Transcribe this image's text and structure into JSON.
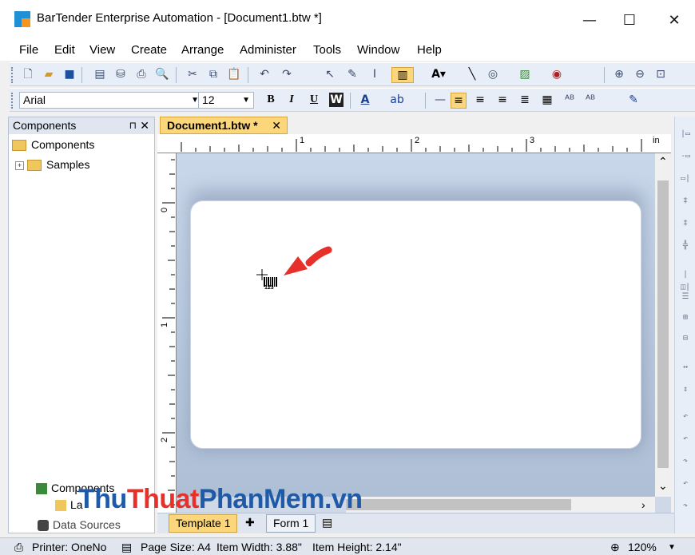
{
  "window": {
    "title": "BarTender Enterprise Automation - [Document1.btw *]",
    "minimize_glyph": "—",
    "maximize_glyph": "☐",
    "close_glyph": "✕"
  },
  "menu": [
    "File",
    "Edit",
    "View",
    "Create",
    "Arrange",
    "Administer",
    "Tools",
    "Window",
    "Help"
  ],
  "toolbar": {
    "font_name": "Arial",
    "font_size": "12",
    "bold_label": "B",
    "italic_label": "I",
    "underline_label": "U",
    "wordart_label": "W",
    "font_color_label": "A"
  },
  "components_panel": {
    "title": "Components",
    "pin_glyph": "⊓",
    "close_glyph": "✕",
    "tree": [
      {
        "label": "Components"
      },
      {
        "label": "Samples",
        "expander": "+"
      }
    ],
    "bottom_tabs": [
      "Components",
      "La",
      "Data Sources"
    ]
  },
  "document": {
    "tab_label": "Document1.btw *",
    "tab_close": "✕",
    "ruler_unit": "in",
    "ruler_marks_h": [
      "1",
      "2",
      "3"
    ],
    "ruler_marks_v": [
      "0",
      "1",
      "2"
    ],
    "barcode_caption": "123"
  },
  "bottom_tabs": [
    "Template 1",
    "Form 1"
  ],
  "watermark": {
    "part1": "Thu",
    "part2": "Thuat",
    "part3": "PhanMem",
    "part4": ".vn",
    "color_dark": "#1e5aa8",
    "color_red": "#e8302a"
  },
  "statusbar": {
    "printer": "Printer: OneNo",
    "page_size": "Page Size: A4",
    "item_width": "Item Width: 3.88\"",
    "item_height": "Item Height: 2.14\"",
    "zoom": "120%"
  }
}
